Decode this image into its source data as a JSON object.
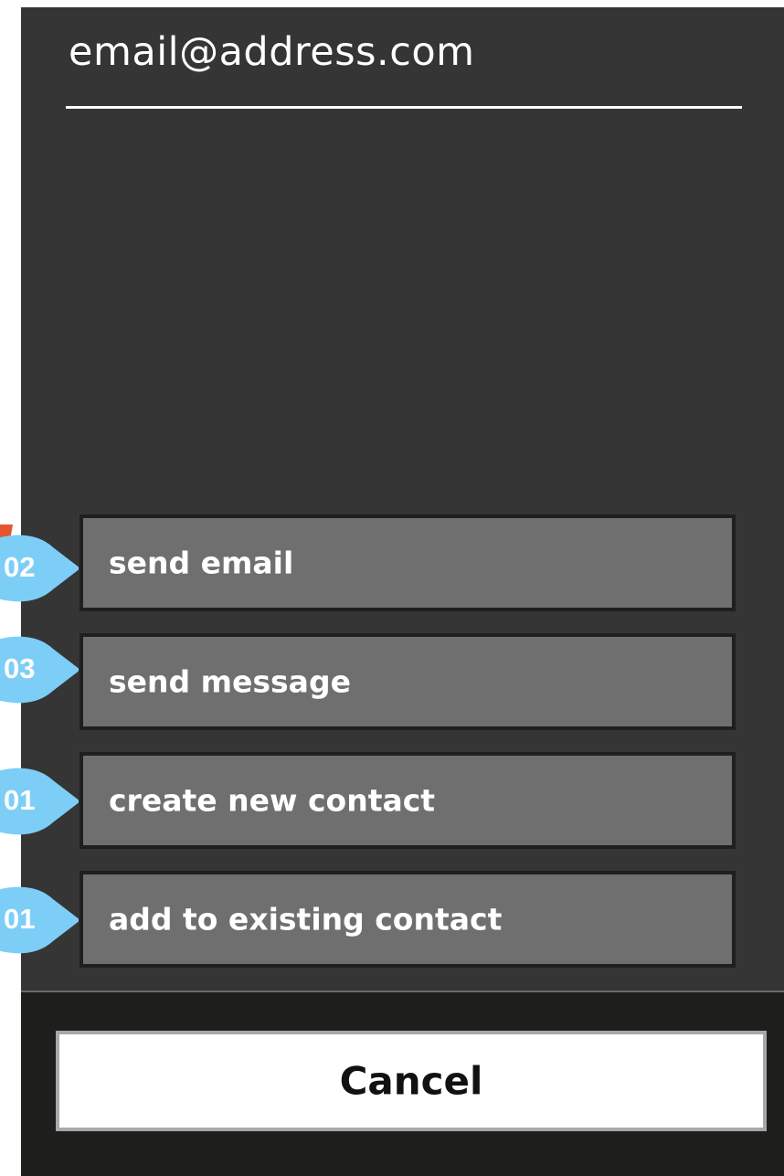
{
  "header": {
    "title": "email@address.com"
  },
  "actions": [
    {
      "label": "send email"
    },
    {
      "label": "send message"
    },
    {
      "label": "create new contact"
    },
    {
      "label": "add to existing contact"
    }
  ],
  "markers": [
    {
      "label": "02"
    },
    {
      "label": "03"
    },
    {
      "label": "01"
    },
    {
      "label": "01"
    }
  ],
  "footer": {
    "cancel_label": "Cancel"
  },
  "colors": {
    "panel": "#353535",
    "button": "#6f6f6f",
    "marker": "#7dcef6",
    "accent": "#e4572e"
  }
}
